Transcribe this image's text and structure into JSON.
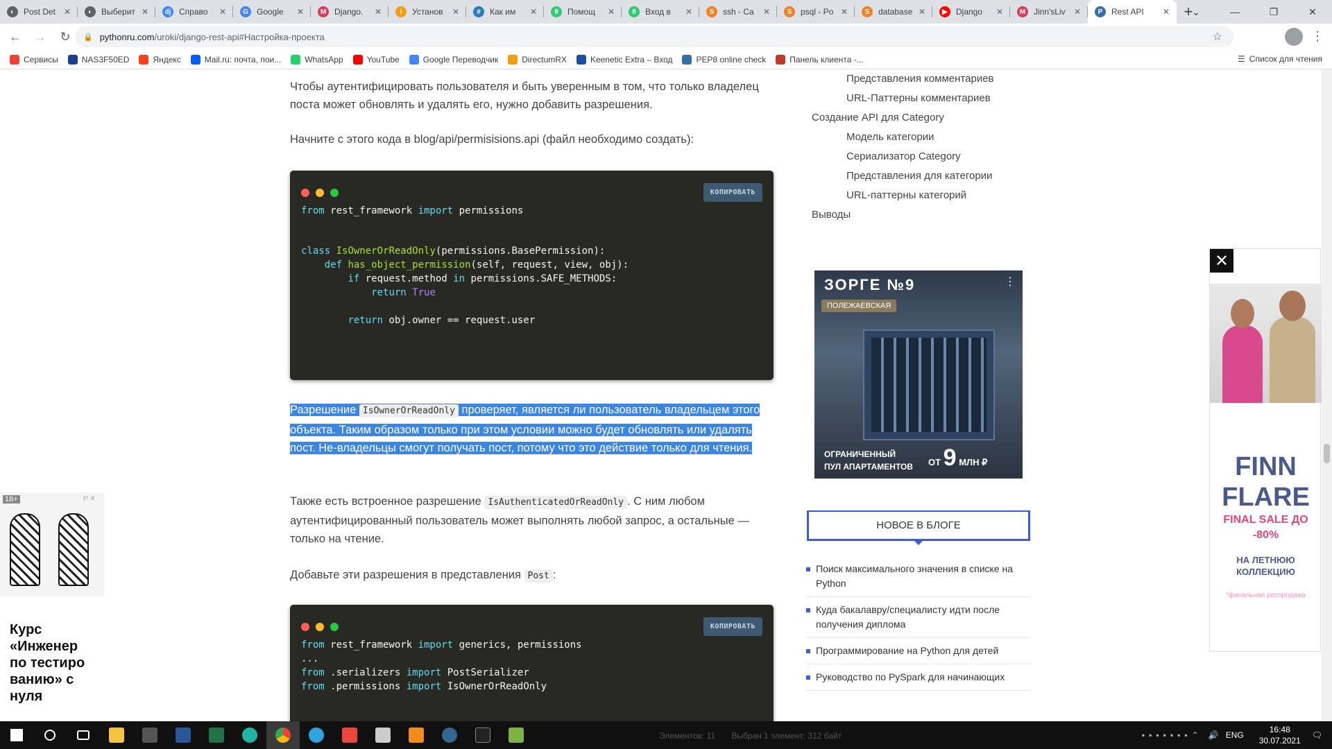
{
  "tabs": [
    {
      "title": "Post Det",
      "color": "#5f6368",
      "glyph": "◐"
    },
    {
      "title": "Выберит",
      "color": "#5f6368",
      "glyph": "◐"
    },
    {
      "title": "Справо",
      "color": "#4285f4",
      "glyph": "dj"
    },
    {
      "title": "Google",
      "color": "#4285f4",
      "glyph": "G"
    },
    {
      "title": "Django.",
      "color": "#d93b5a",
      "glyph": "M"
    },
    {
      "title": "Установ",
      "color": "#f39c12",
      "glyph": "i"
    },
    {
      "title": "Как им",
      "color": "#2b7bb9",
      "glyph": "#"
    },
    {
      "title": "Помощ",
      "color": "#2ecc71",
      "glyph": "8"
    },
    {
      "title": "Вход в",
      "color": "#2ecc71",
      "glyph": "8"
    },
    {
      "title": "ssh - Ca",
      "color": "#f48024",
      "glyph": "S"
    },
    {
      "title": "psql - Po",
      "color": "#f48024",
      "glyph": "S"
    },
    {
      "title": "database",
      "color": "#f48024",
      "glyph": "S"
    },
    {
      "title": "Django",
      "color": "#ff0000",
      "glyph": "▶"
    },
    {
      "title": "Jinn'sLiv",
      "color": "#d93b5a",
      "glyph": "M"
    },
    {
      "title": "Rest API",
      "color": "#356fa8",
      "glyph": "P"
    }
  ],
  "omnibox": {
    "host": "pythonru.com",
    "path": "/uroki/django-rest-api#Настройка-проекта"
  },
  "bookmarks": [
    {
      "label": "Сервисы",
      "color": "#ea4335"
    },
    {
      "label": "NAS3F50ED",
      "color": "#1a3d8f"
    },
    {
      "label": "Яндекс",
      "color": "#fc3f1d"
    },
    {
      "label": "Mail.ru: почта, пои...",
      "color": "#005ff9"
    },
    {
      "label": "WhatsApp",
      "color": "#25d366"
    },
    {
      "label": "YouTube",
      "color": "#ff0000"
    },
    {
      "label": "Google Переводчик",
      "color": "#4285f4"
    },
    {
      "label": "DirectumRX",
      "color": "#f39c12"
    },
    {
      "label": "Keenetic Extra – Вход",
      "color": "#1c4fa0"
    },
    {
      "label": "PEP8 online check",
      "color": "#356fa8"
    },
    {
      "label": "Панель клиента -...",
      "color": "#c0392b"
    }
  ],
  "reading_list": "Список для чтения",
  "article": {
    "p1": "Чтобы аутентифицировать пользователя и быть уверенным в том, что только владелец поста может обновлять и удалять его, нужно добавить разрешения.",
    "p2": "Начните с этого кода в blog/api/permisisions.api (файл необходимо создать):",
    "copy_label": "КОПИРОВАТЬ",
    "code1": {
      "l1_kw1": "from",
      "l1_mod": " rest_framework ",
      "l1_kw2": "import",
      "l1_rest": " permissions",
      "l2_kw": "class",
      "l2_name": "IsOwnerOrReadOnly",
      "l2_rest": "(permissions.BasePermission):",
      "l3_kw": "def",
      "l3_name": "has_object_permission",
      "l3_rest": "(self, request, view, obj):",
      "l4_kw": "if",
      "l4_a": " request.method ",
      "l4_kw2": "in",
      "l4_b": " permissions.SAFE_METHODS:",
      "l5_kw": "return",
      "l5_val": "True",
      "l6_kw": "return",
      "l6_rest": " obj.owner == request.user"
    },
    "p3_a": "Разрешение ",
    "p3_code": "IsOwnerOrReadOnly",
    "p3_b": " проверяет, является ли пользователь владельцем этого объекта. Таким образом только при этом условии можно будет обновлять или удалять пост. Не-владельцы смогут получать пост, потому что это действие только для чтения.",
    "p4_a": "Также есть встроенное разрешение ",
    "p4_code": "IsAuthenticatedOrReadOnly",
    "p4_b": ". С ним любом аутентифицированный пользователь может выполнять любой запрос, а остальные — только на чтение.",
    "p5_a": "Добавьте эти разрешения в представления ",
    "p5_code": "Post",
    "p5_b": ":",
    "code2": {
      "l1_kw1": "from",
      "l1_mod": " rest_framework ",
      "l1_kw2": "import",
      "l1_rest": " generics, permissions",
      "l2": "...",
      "l3_kw1": "from",
      "l3_mod": " .serializers ",
      "l3_kw2": "import",
      "l3_rest": " PostSerializer",
      "l4_kw1": "from",
      "l4_mod": " .permissions ",
      "l4_kw2": "import",
      "l4_rest": " IsOwnerOrReadOnly"
    }
  },
  "toc": {
    "i1": "Представления комментариев",
    "i2": "URL-Паттерны комментариев",
    "i3": "Создание API для Category",
    "i4": "Модель категории",
    "i5": "Сериализатор Category",
    "i6": "Представления для категории",
    "i7": "URL-паттерны категорий",
    "i8": "Выводы"
  },
  "ad_building": {
    "title": "ЗОРГЕ №9",
    "metro": "ПОЛЕЖАЕВСКАЯ",
    "line1": "ОГРАНИЧЕННЫЙ",
    "line2": "ПУЛ АПАРТАМЕНТОВ",
    "price_from": "ОТ ",
    "price_num": "9",
    "price_unit": " МЛН ₽"
  },
  "new_blog": {
    "heading": "НОВОЕ В БЛОГЕ",
    "items": [
      "Поиск максимального значения в списке на Python",
      "Куда бакалавру/специалисту идти после получения диплома",
      "Программирование на Python для детей",
      "Руководство по PySpark для начинающих"
    ]
  },
  "left_ad": {
    "age": "18+",
    "pr": "P ✕",
    "text": "Курс «Инженер по тестиро ванию» с нуля"
  },
  "right_ad": {
    "close": "✕",
    "brand": "FINN FLARE",
    "sale": "FINAL SALE ДО -80%",
    "collection": "НА ЛЕТНЮЮ КОЛЛЕКЦИЮ",
    "note": "*финальная распродажа"
  },
  "taskbar": {
    "status_left": "Элементов: 11",
    "status_right": "Выбран 1 элемент: 312 байт",
    "lang": "ENG",
    "time": "16:48",
    "date": "30.07.2021"
  }
}
